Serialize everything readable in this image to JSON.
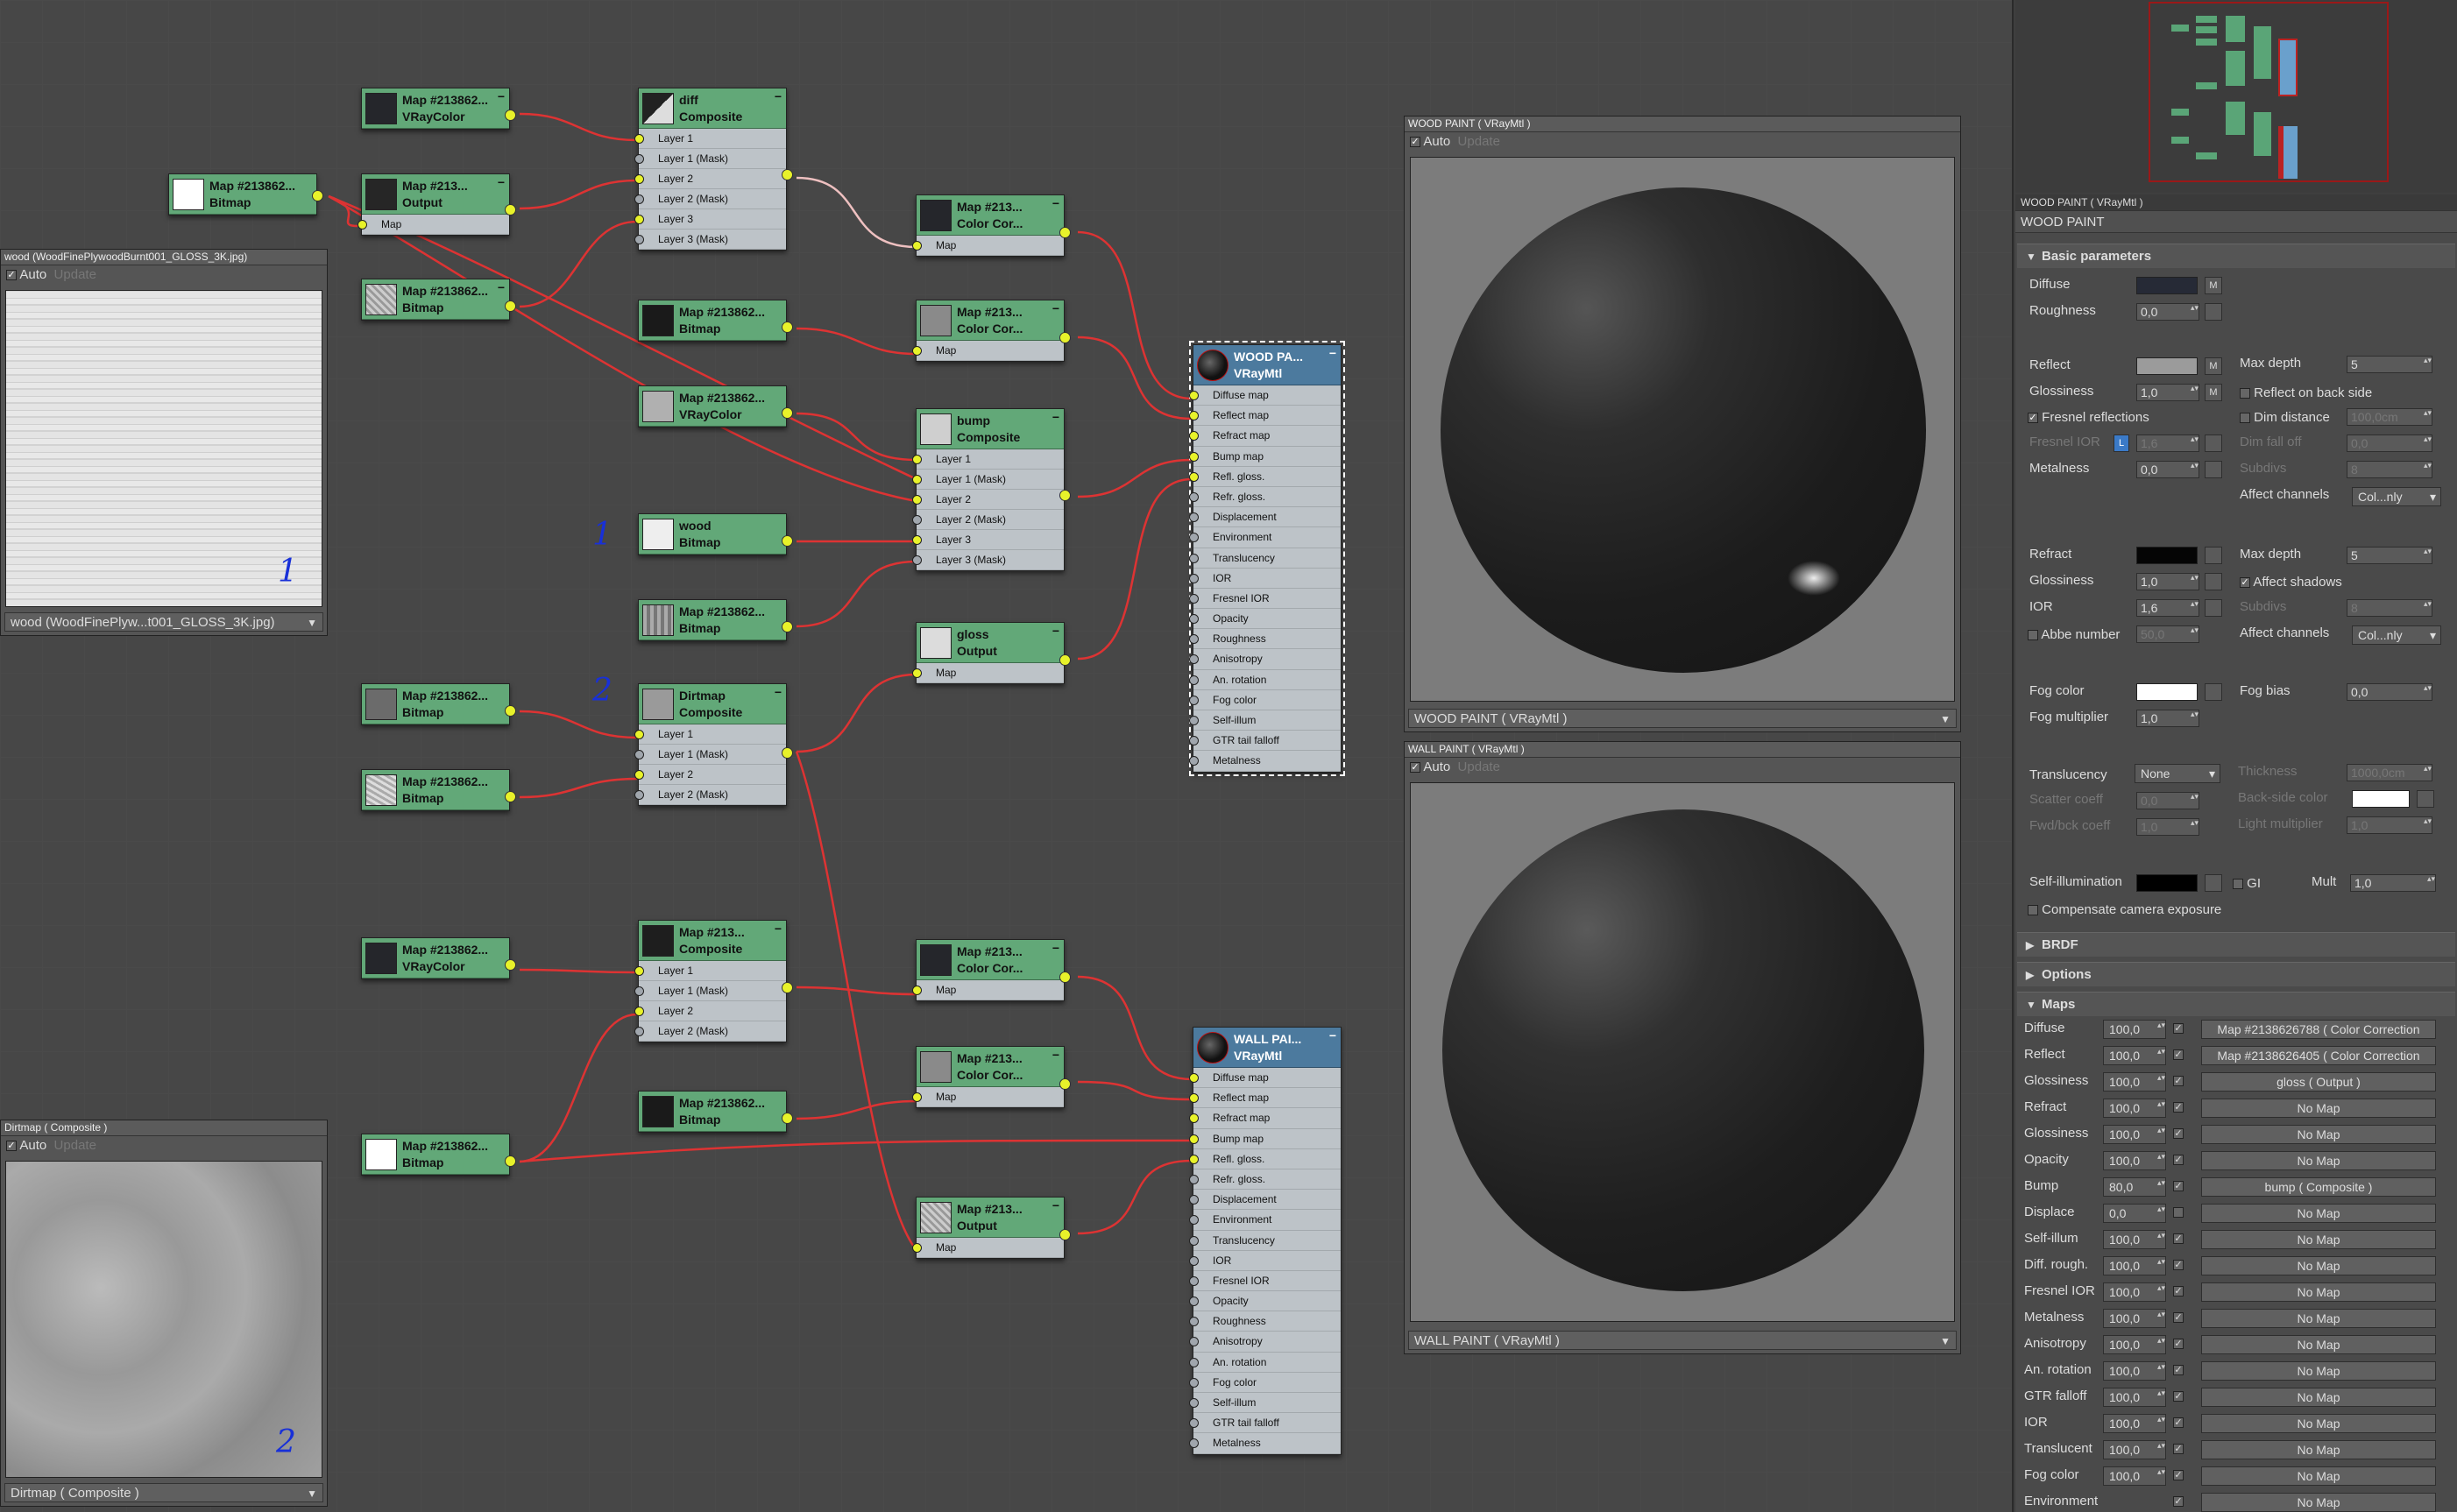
{
  "nodes": {
    "n_vc1": {
      "title": "Map #213862...",
      "type": "VRayColor"
    },
    "n_out1": {
      "title": "Map #213...",
      "type": "Output",
      "slots": [
        "Map"
      ]
    },
    "n_bmp_white": {
      "title": "Map #213862...",
      "type": "Bitmap"
    },
    "n_bmp_a": {
      "title": "Map #213862...",
      "type": "Bitmap"
    },
    "n_diff": {
      "title": "diff",
      "type": "Composite",
      "slots": [
        "Layer 1",
        "Layer 1 (Mask)",
        "Layer 2",
        "Layer 2 (Mask)",
        "Layer 3",
        "Layer 3 (Mask)"
      ]
    },
    "n_bmp_b": {
      "title": "Map #213862...",
      "type": "Bitmap"
    },
    "n_vc2": {
      "title": "Map #213862...",
      "type": "VRayColor"
    },
    "n_wood": {
      "title": "wood",
      "type": "Bitmap"
    },
    "n_bmp_c": {
      "title": "Map #213862...",
      "type": "Bitmap"
    },
    "n_cc1": {
      "title": "Map #213...",
      "type": "Color Cor...",
      "slots": [
        "Map"
      ]
    },
    "n_cc2": {
      "title": "Map #213...",
      "type": "Color Cor...",
      "slots": [
        "Map"
      ]
    },
    "n_bump": {
      "title": "bump",
      "type": "Composite",
      "slots": [
        "Layer 1",
        "Layer 1 (Mask)",
        "Layer 2",
        "Layer 2 (Mask)",
        "Layer 3",
        "Layer 3 (Mask)"
      ]
    },
    "n_gloss": {
      "title": "gloss",
      "type": "Output",
      "slots": [
        "Map"
      ]
    },
    "n_bmp_d": {
      "title": "Map #213862...",
      "type": "Bitmap"
    },
    "n_bmp_e": {
      "title": "Map #213862...",
      "type": "Bitmap"
    },
    "n_dirt": {
      "title": "Dirtmap",
      "type": "Composite",
      "slots": [
        "Layer 1",
        "Layer 1 (Mask)",
        "Layer 2",
        "Layer 2 (Mask)"
      ]
    },
    "n_vc3": {
      "title": "Map #213862...",
      "type": "VRayColor"
    },
    "n_comp3": {
      "title": "Map #213...",
      "type": "Composite",
      "slots": [
        "Layer 1",
        "Layer 1 (Mask)",
        "Layer 2",
        "Layer 2 (Mask)"
      ]
    },
    "n_bmp_f": {
      "title": "Map #213862...",
      "type": "Bitmap"
    },
    "n_bmp_white2": {
      "title": "Map #213862...",
      "type": "Bitmap"
    },
    "n_cc3": {
      "title": "Map #213...",
      "type": "Color Cor...",
      "slots": [
        "Map"
      ]
    },
    "n_cc4": {
      "title": "Map #213...",
      "type": "Color Cor...",
      "slots": [
        "Map"
      ]
    },
    "n_out2": {
      "title": "Map #213...",
      "type": "Output",
      "slots": [
        "Map"
      ]
    },
    "n_woodpaint": {
      "title": "WOOD PA...",
      "type": "VRayMtl",
      "slots": [
        "Diffuse map",
        "Reflect map",
        "Refract map",
        "Bump map",
        "Refl. gloss.",
        "Refr. gloss.",
        "Displacement",
        "Environment",
        "Translucency",
        "IOR",
        "Fresnel IOR",
        "Opacity",
        "Roughness",
        "Anisotropy",
        "An. rotation",
        "Fog color",
        "Self-illum",
        "GTR tail falloff",
        "Metalness"
      ]
    },
    "n_wallpaint": {
      "title": "WALL PAI...",
      "type": "VRayMtl",
      "slots": [
        "Diffuse map",
        "Reflect map",
        "Refract map",
        "Bump map",
        "Refl. gloss.",
        "Refr. gloss.",
        "Displacement",
        "Environment",
        "Translucency",
        "IOR",
        "Fresnel IOR",
        "Opacity",
        "Roughness",
        "Anisotropy",
        "An. rotation",
        "Fog color",
        "Self-illum",
        "GTR tail falloff",
        "Metalness"
      ]
    }
  },
  "annotations": {
    "mark1": "1",
    "mark2": "2",
    "tex1mark": "1",
    "tex2mark": "2"
  },
  "tex_viewer_1": {
    "title": "wood (WoodFinePlywoodBurnt001_GLOSS_3K.jpg)",
    "auto": "Auto",
    "update": "Update",
    "bottom": "wood (WoodFinePlyw...t001_GLOSS_3K.jpg)"
  },
  "tex_viewer_2": {
    "title": "Dirtmap  ( Composite )",
    "auto": "Auto",
    "update": "Update",
    "bottom": "Dirtmap  ( Composite )"
  },
  "preview_1": {
    "title": "WOOD PAINT  ( VRayMtl )",
    "auto": "Auto",
    "update": "Update",
    "bottom": "WOOD PAINT  ( VRayMtl )"
  },
  "preview_2": {
    "title": "WALL PAINT  ( VRayMtl )",
    "auto": "Auto",
    "update": "Update",
    "bottom": "WALL PAINT  ( VRayMtl )"
  },
  "params": {
    "header": "WOOD PAINT  ( VRayMtl )",
    "name": "WOOD PAINT",
    "basic": "Basic parameters",
    "diffuse": "Diffuse",
    "diffuse_color": "#262a36",
    "m": "M",
    "roughness": "Roughness",
    "roughness_val": "0,0",
    "reflect": "Reflect",
    "reflect_color": "#9b9b9b",
    "max_depth": "Max depth",
    "max_depth_val": "5",
    "glossiness": "Glossiness",
    "glossiness_val": "1,0",
    "reflect_backside": "Reflect on back side",
    "fresnel": "Fresnel reflections",
    "dim_distance": "Dim distance",
    "dim_distance_val": "100,0cm",
    "fresnel_ior": "Fresnel IOR",
    "l": "L",
    "fresnel_ior_val": "1,6",
    "dim_falloff": "Dim fall off",
    "dim_falloff_val": "0,0",
    "metalness": "Metalness",
    "metalness_val": "0,0",
    "subdivs": "Subdivs",
    "subdivs_val": "8",
    "affect_channels": "Affect channels",
    "affect_val": "Col...nly",
    "refract": "Refract",
    "refract_color": "#050505",
    "refr_max_depth_val": "5",
    "refr_glossiness_val": "1,0",
    "affect_shadows": "Affect shadows",
    "ior": "IOR",
    "ior_val": "1,6",
    "refr_subdivs_val": "8",
    "abbe": "Abbe number",
    "abbe_val": "50,0",
    "refr_affect_val": "Col...nly",
    "fog_color": "Fog color",
    "fog_color_val": "#ffffff",
    "fog_bias": "Fog bias",
    "fog_bias_val": "0,0",
    "fog_mult": "Fog multiplier",
    "fog_mult_val": "1,0",
    "translucency": "Translucency",
    "transl_val": "None",
    "thickness": "Thickness",
    "thickness_val": "1000,0cm",
    "scatter": "Scatter coeff",
    "scatter_val": "0,0",
    "backside_color": "Back-side color",
    "fwdbck": "Fwd/bck coeff",
    "fwdbck_val": "1,0",
    "light_mult": "Light multiplier",
    "light_mult_val": "1,0",
    "self_illum": "Self-illumination",
    "gi": "GI",
    "mult": "Mult",
    "mult_val": "1,0",
    "compensate": "Compensate camera exposure",
    "brdf": "BRDF",
    "options": "Options",
    "maps": "Maps"
  },
  "maps_rows": [
    {
      "label": "Diffuse",
      "amt": "100,0",
      "checked": true,
      "map": "Map #2138626788  ( Color Correction"
    },
    {
      "label": "Reflect",
      "amt": "100,0",
      "checked": true,
      "map": "Map #2138626405  ( Color Correction"
    },
    {
      "label": "Glossiness",
      "amt": "100,0",
      "checked": true,
      "map": "gloss  ( Output )"
    },
    {
      "label": "Refract",
      "amt": "100,0",
      "checked": true,
      "map": "No Map"
    },
    {
      "label": "Glossiness",
      "amt": "100,0",
      "checked": true,
      "map": "No Map"
    },
    {
      "label": "Opacity",
      "amt": "100,0",
      "checked": true,
      "map": "No Map"
    },
    {
      "label": "Bump",
      "amt": "80,0",
      "checked": true,
      "map": "bump  ( Composite )"
    },
    {
      "label": "Displace",
      "amt": "0,0",
      "checked": false,
      "map": "No Map"
    },
    {
      "label": "Self-illum",
      "amt": "100,0",
      "checked": true,
      "map": "No Map"
    },
    {
      "label": "Diff. rough.",
      "amt": "100,0",
      "checked": true,
      "map": "No Map"
    },
    {
      "label": "Fresnel IOR",
      "amt": "100,0",
      "checked": true,
      "map": "No Map"
    },
    {
      "label": "Metalness",
      "amt": "100,0",
      "checked": true,
      "map": "No Map"
    },
    {
      "label": "Anisotropy",
      "amt": "100,0",
      "checked": true,
      "map": "No Map"
    },
    {
      "label": "An. rotation",
      "amt": "100,0",
      "checked": true,
      "map": "No Map"
    },
    {
      "label": "GTR falloff",
      "amt": "100,0",
      "checked": true,
      "map": "No Map"
    },
    {
      "label": "IOR",
      "amt": "100,0",
      "checked": true,
      "map": "No Map"
    },
    {
      "label": "Translucent",
      "amt": "100,0",
      "checked": true,
      "map": "No Map"
    },
    {
      "label": "Fog color",
      "amt": "100,0",
      "checked": true,
      "map": "No Map"
    },
    {
      "label": "Environment",
      "amt": "",
      "checked": true,
      "map": "No Map"
    }
  ]
}
